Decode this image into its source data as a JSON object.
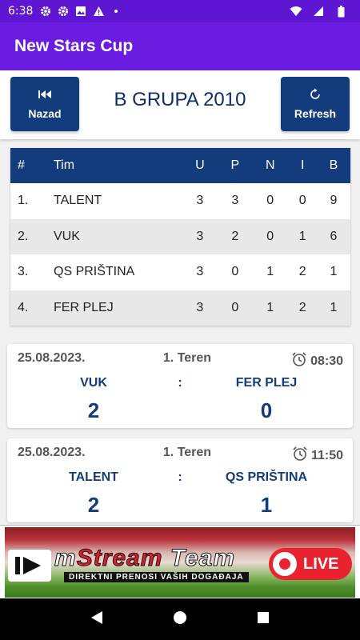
{
  "status_bar": {
    "time": "6:38",
    "icons": [
      "gear-icon",
      "gear-icon",
      "image-icon",
      "warning-icon",
      "dot-icon"
    ],
    "right_icons": [
      "wifi-icon",
      "signal-icon",
      "battery-icon"
    ]
  },
  "app_bar": {
    "title": "New Stars Cup"
  },
  "header": {
    "back_label": "Nazad",
    "title": "B GRUPA 2010",
    "refresh_label": "Refresh"
  },
  "standings": {
    "headers": [
      "#",
      "Tim",
      "U",
      "P",
      "N",
      "I",
      "B"
    ],
    "rows": [
      [
        "1.",
        "TALENT",
        "3",
        "3",
        "0",
        "0",
        "9"
      ],
      [
        "2.",
        "VUK",
        "3",
        "2",
        "0",
        "1",
        "6"
      ],
      [
        "3.",
        "QS PRIŠTINA",
        "3",
        "0",
        "1",
        "2",
        "1"
      ],
      [
        "4.",
        "FER PLEJ",
        "3",
        "0",
        "1",
        "2",
        "1"
      ]
    ]
  },
  "matches": [
    {
      "date": "25.08.2023.",
      "field": "1. Teren",
      "time": "08:30",
      "home": "VUK",
      "separator": ":",
      "away": "FER PLEJ",
      "home_score": "2",
      "away_score": "0"
    },
    {
      "date": "25.08.2023.",
      "field": "1. Teren",
      "time": "11:50",
      "home": "TALENT",
      "separator": ":",
      "away": "QS PRIŠTINA",
      "home_score": "2",
      "away_score": "1"
    }
  ],
  "ad": {
    "brand_prefix": "m",
    "brand_stream": "Stream",
    "brand_team": " Team",
    "tagline": "DIREKTNI PRENOSI VAŠIH DOGAĐAJA",
    "live": "LIVE"
  },
  "colors": {
    "status_bar": "#5f16d2",
    "app_bar": "#6a1de0",
    "primary": "#123c7c",
    "title": "#0f2e69",
    "live_red": "#e8232f"
  }
}
